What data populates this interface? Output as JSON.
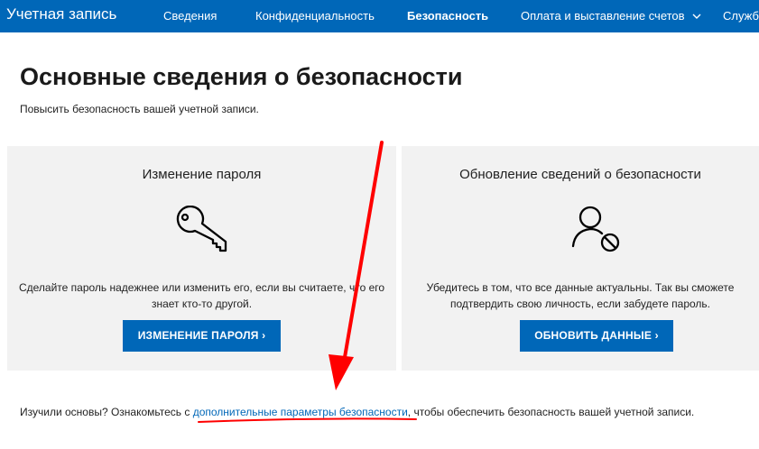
{
  "nav": {
    "brand": "Учетная запись",
    "items": [
      {
        "label": "Сведения",
        "active": false
      },
      {
        "label": "Конфиденциальность",
        "active": false
      },
      {
        "label": "Безопасность",
        "active": true
      },
      {
        "label": "Оплата и выставление счетов",
        "active": false,
        "has_dropdown": true
      },
      {
        "label": "Службы",
        "active": false
      }
    ]
  },
  "page": {
    "title": "Основные сведения о безопасности",
    "subtitle": "Повысить безопасность вашей учетной записи."
  },
  "cards": [
    {
      "title": "Изменение пароля",
      "icon": "key-icon",
      "text": "Сделайте пароль надежнее или изменить его, если вы считаете, что его знает кто-то другой.",
      "button": "ИЗМЕНЕНИЕ ПАРОЛЯ ›"
    },
    {
      "title": "Обновление сведений о безопасности",
      "icon": "user-blocked-icon",
      "text": "Убедитесь в том, что все данные актуальны. Так вы сможете подтвердить свою личность, если забудете пароль.",
      "button": "ОБНОВИТЬ ДАННЫЕ ›"
    }
  ],
  "footer": {
    "prefix": "Изучили основы? Ознакомьтесь с ",
    "link": "дополнительные параметры безопасности",
    "suffix": ", чтобы обеспечить безопасность вашей учетной записи."
  },
  "colors": {
    "nav_bg": "#0067b8",
    "button_bg": "#0067b8",
    "card_bg": "#f2f2f2",
    "link": "#0067b8",
    "annotation": "#ff0000"
  }
}
